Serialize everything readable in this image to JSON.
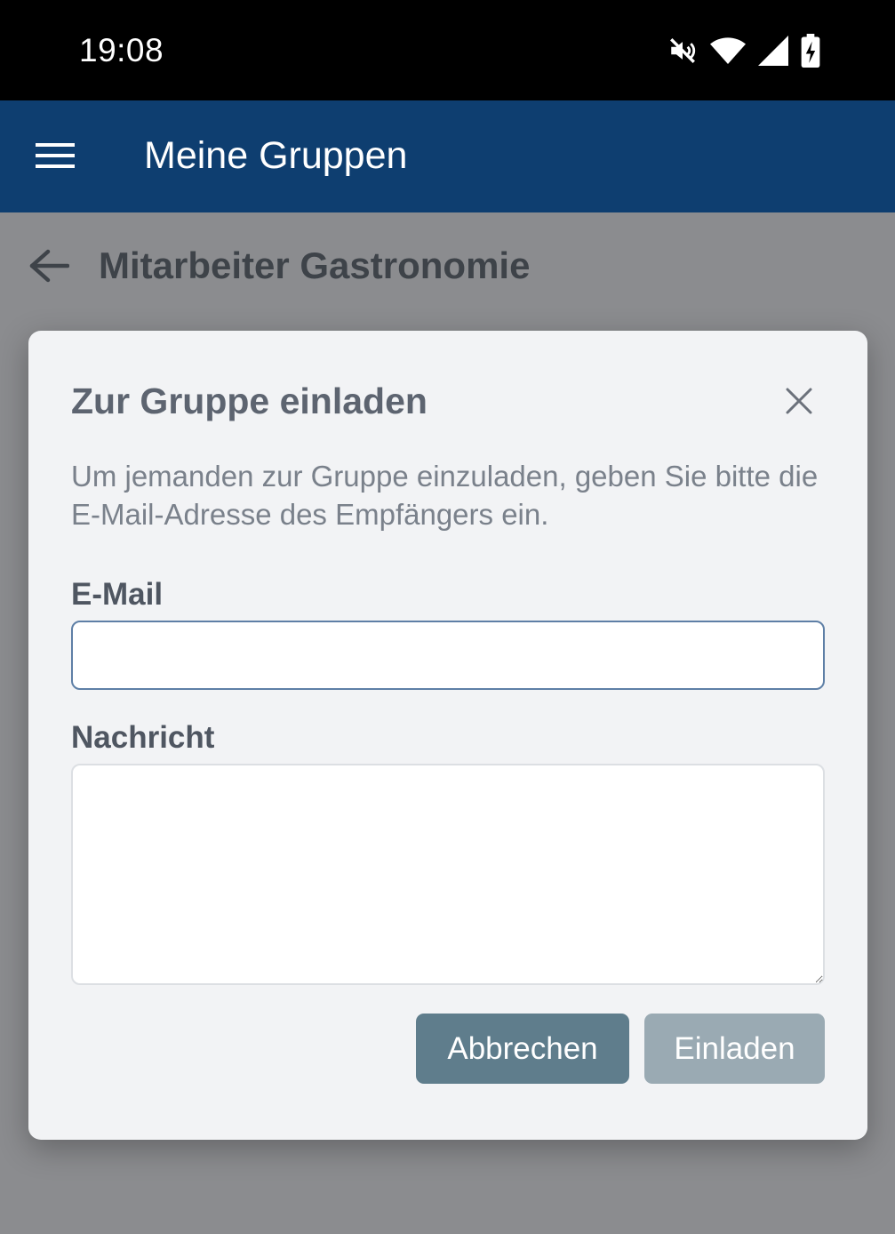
{
  "status_bar": {
    "time": "19:08",
    "icons": [
      "mute-icon",
      "wifi-icon",
      "signal-icon",
      "battery-charging-icon"
    ]
  },
  "app_bar": {
    "title": "Meine Gruppen",
    "menu_icon": "menu-icon"
  },
  "page": {
    "back_icon": "arrow-left-icon",
    "group_title": "Mitarbeiter Gastronomie"
  },
  "dialog": {
    "title": "Zur Gruppe einladen",
    "close_icon": "close-icon",
    "description": "Um jemanden zur Gruppe einzuladen, geben Sie bitte die E-Mail-Adresse des Empfängers ein.",
    "email_label": "E-Mail",
    "email_value": "",
    "message_label": "Nachricht",
    "message_value": "",
    "cancel_label": "Abbrechen",
    "invite_label": "Einladen"
  },
  "colors": {
    "status_bar": "#000000",
    "app_bar": "#0e3e70",
    "overlay": "#8b8c8f",
    "dialog_bg": "#f2f3f5",
    "cancel_button": "#5f7d8c",
    "invite_button_disabled": "#9aaab3",
    "email_focus_border": "#5e7fa6"
  }
}
